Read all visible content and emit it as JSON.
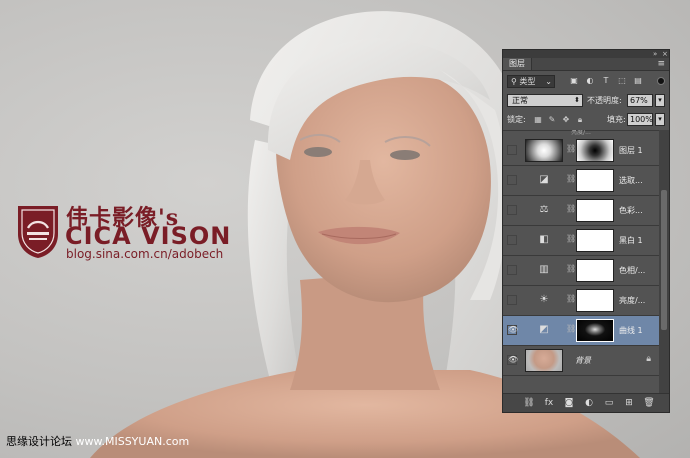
{
  "watermark": {
    "brand_cn": "伟卡影像's",
    "brand_en": "CICA VISON",
    "url": "blog.sina.com.cn/adobech",
    "footer_left": "思缘设计论坛",
    "footer_right": "www.MISSYUAN.com"
  },
  "layers_panel": {
    "tab_label": "图层",
    "filter": {
      "kind_label": "类型",
      "icons": [
        "image-filter-icon",
        "adjustment-filter-icon",
        "type-filter-icon",
        "shape-filter-icon",
        "smart-object-filter-icon"
      ]
    },
    "blend_mode": "正常",
    "opacity_label": "不透明度:",
    "opacity_value": "67%",
    "lock_label": "锁定:",
    "fill_label": "填充:",
    "fill_value": "100%",
    "partial_top_text": "亮度/...",
    "layers": [
      {
        "name": "图层 1",
        "visible": false,
        "type": "pixel-with-mask",
        "selected": false
      },
      {
        "name": "选取...",
        "visible": false,
        "type": "selective-color",
        "icon": "selective-color-icon",
        "selected": false
      },
      {
        "name": "色彩...",
        "visible": false,
        "type": "color-balance",
        "icon": "balance-scale-icon",
        "selected": false
      },
      {
        "name": "黑白 1",
        "visible": false,
        "type": "black-white",
        "icon": "black-white-icon",
        "selected": false
      },
      {
        "name": "色相/...",
        "visible": false,
        "type": "hue-saturation",
        "icon": "hue-saturation-icon",
        "selected": false
      },
      {
        "name": "亮度/...",
        "visible": false,
        "type": "brightness-contrast",
        "icon": "sun-icon",
        "selected": false
      },
      {
        "name": "曲线 1",
        "visible": true,
        "type": "curves",
        "icon": "curves-icon",
        "selected": true
      },
      {
        "name": "背景",
        "visible": true,
        "type": "background",
        "selected": false
      }
    ],
    "bottom_icons": [
      "link-layers-icon",
      "fx-icon",
      "add-mask-icon",
      "new-adjustment-icon",
      "new-group-icon",
      "new-layer-icon",
      "trash-icon"
    ]
  }
}
